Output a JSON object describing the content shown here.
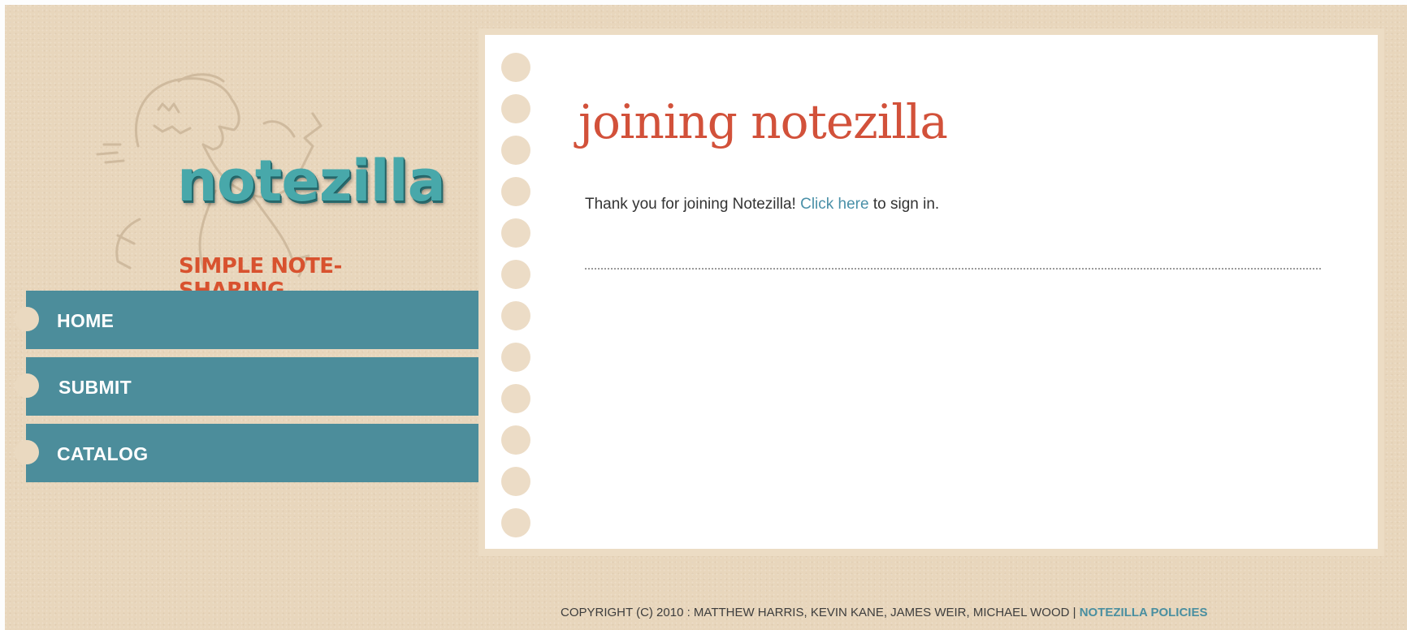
{
  "brand": {
    "logo_text": "notezilla",
    "tagline": "SIMPLE NOTE-SHARING"
  },
  "nav": {
    "items": [
      {
        "label": "HOME"
      },
      {
        "label": "SUBMIT"
      },
      {
        "label": "CATALOG"
      }
    ]
  },
  "main": {
    "title": "joining notezilla",
    "message_before": "Thank you for joining Notezilla! ",
    "link_text": "Click here",
    "message_after": " to sign in."
  },
  "footer": {
    "copyright": "COPYRIGHT (C) 2010 : MATTHEW HARRIS, KEVIN KANE, JAMES WEIR, MICHAEL WOOD | ",
    "policies_link": "NOTEZILLA POLICIES"
  },
  "colors": {
    "background": "#e8d6bc",
    "nav": "#4c8d9b",
    "title": "#d2513a",
    "link": "#4a90a8",
    "tagline": "#d8522f",
    "logo": "#48a8aa"
  },
  "icons": {
    "mascot": "dinosaur-icon"
  }
}
